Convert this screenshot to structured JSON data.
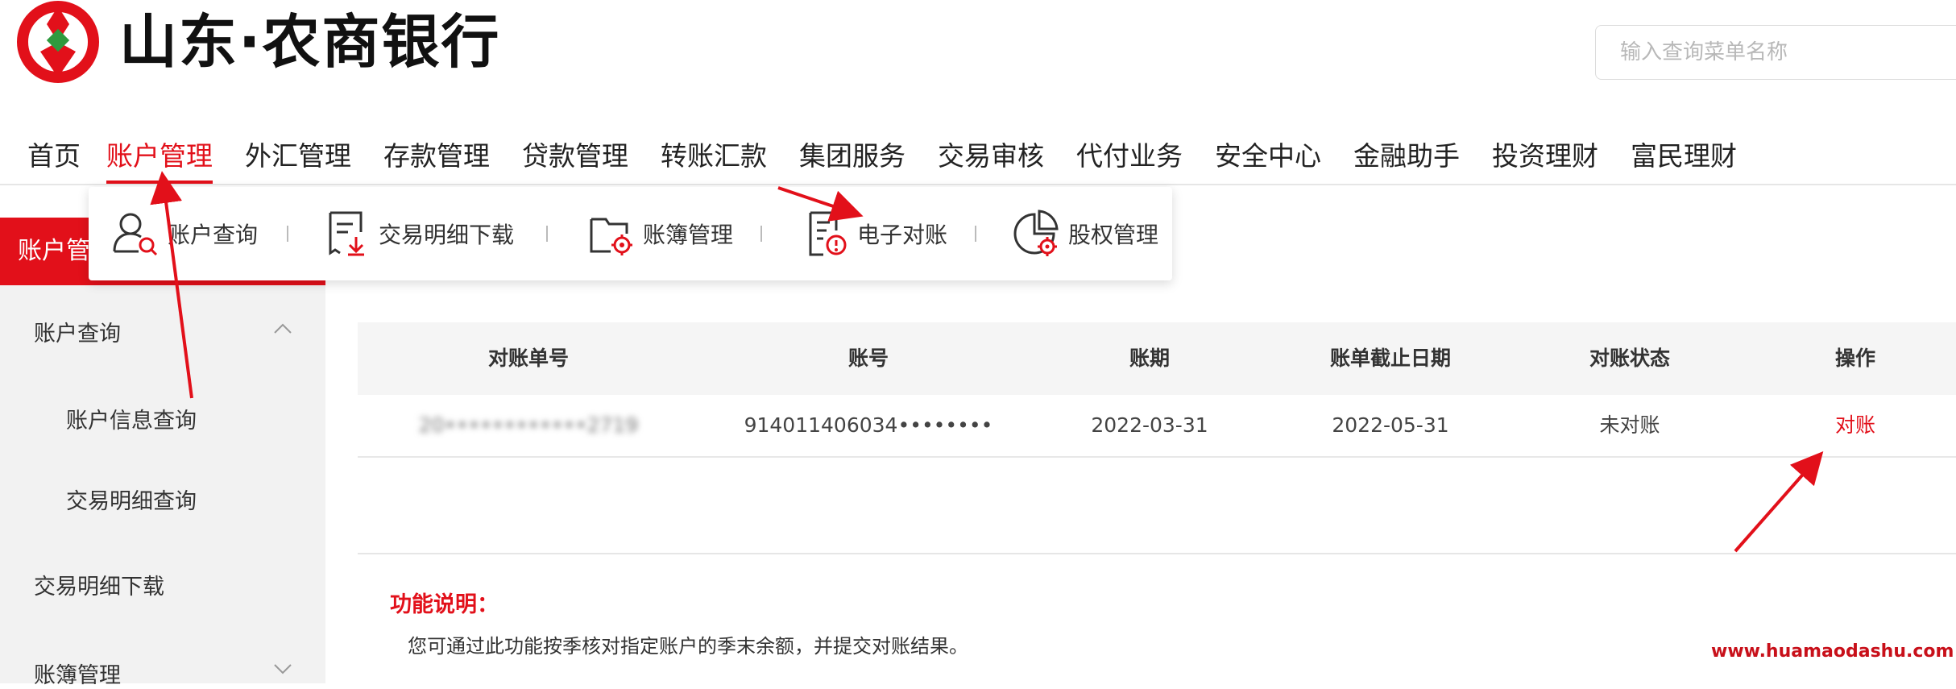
{
  "header": {
    "brand_name": "山东·农商银行",
    "search_placeholder": "输入查询菜单名称"
  },
  "nav": {
    "items": [
      "首页",
      "账户管理",
      "外汇管理",
      "存款管理",
      "贷款管理",
      "转账汇款",
      "集团服务",
      "交易审核",
      "代付业务",
      "安全中心",
      "金融助手",
      "投资理财",
      "富民理财"
    ],
    "active": "账户管理"
  },
  "submenu": {
    "items": [
      {
        "label": "账户查询",
        "icon": "user-search-icon"
      },
      {
        "label": "交易明细下载",
        "icon": "receipt-download-icon"
      },
      {
        "label": "账簿管理",
        "icon": "folder-gear-icon"
      },
      {
        "label": "电子对账",
        "icon": "document-check-icon"
      },
      {
        "label": "股权管理",
        "icon": "pie-chart-gear-icon"
      }
    ]
  },
  "sidebar": {
    "title": "账户管理",
    "items": [
      {
        "label": "账户查询",
        "expanded": true
      },
      {
        "label": "账户信息查询"
      },
      {
        "label": "交易明细查询"
      },
      {
        "label": "交易明细下载"
      },
      {
        "label": "账簿管理",
        "expanded": false
      }
    ]
  },
  "table": {
    "columns": [
      "对账单号",
      "账号",
      "账期",
      "账单截止日期",
      "对账状态",
      "操作"
    ],
    "rows": [
      {
        "statement_no": "20••••••••••••2719",
        "account_no": "914011406034••••••••",
        "period": "2022-03-31",
        "cutoff_date": "2022-05-31",
        "status": "未对账",
        "action": "对账"
      }
    ]
  },
  "description": {
    "title": "功能说明：",
    "text": "您可通过此功能按季核对指定账户的季末余额，并提交对账结果。"
  },
  "watermark": "www.huamaodashu.com",
  "colors": {
    "brand_red": "#e2101a",
    "logo_green": "#2e9a3e",
    "sidebar_bg": "#f2f2f2",
    "table_header_bg": "#f5f5f5"
  }
}
